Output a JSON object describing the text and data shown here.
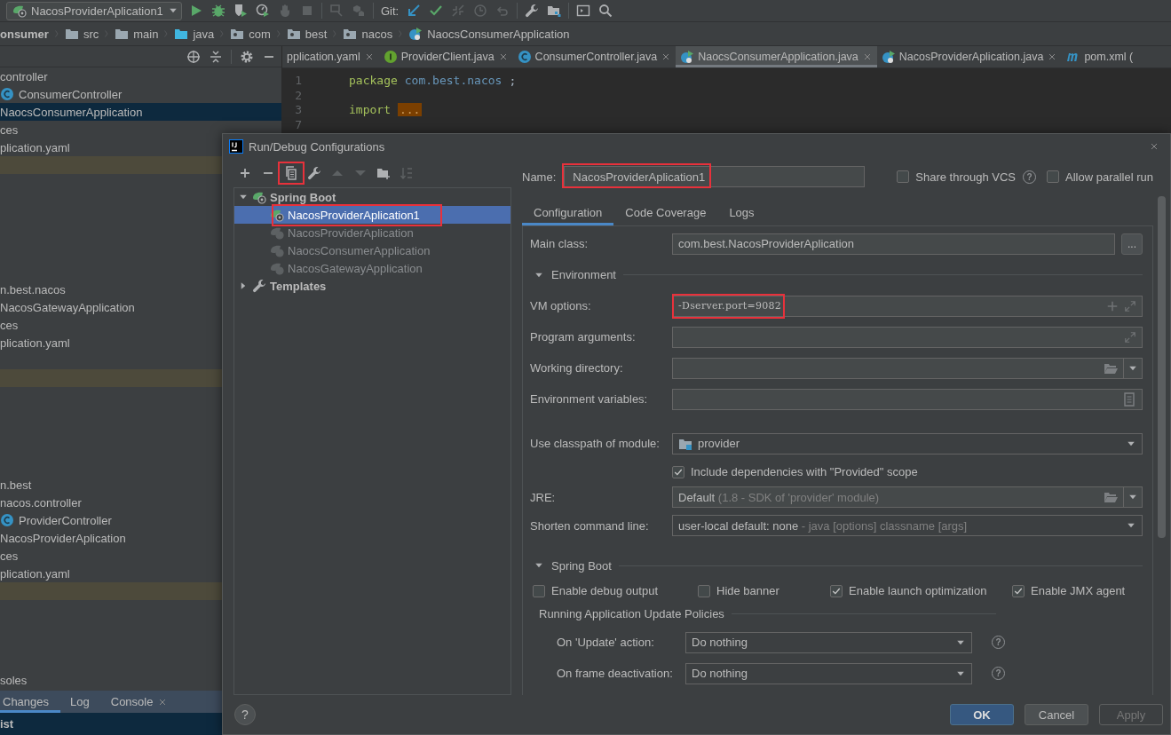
{
  "toolbar": {
    "run_config": "NacosProviderAplication1",
    "groups": [
      {
        "actions": [
          {
            "kind": "run",
            "disabled": false
          },
          {
            "kind": "debug",
            "disabled": false
          },
          {
            "kind": "coverage",
            "disabled": false
          },
          {
            "kind": "profile",
            "disabled": false
          },
          {
            "kind": "attach",
            "disabled": true
          },
          {
            "kind": "stop",
            "disabled": true
          }
        ]
      },
      {
        "actions": [
          {
            "kind": "build",
            "disabled": true
          },
          {
            "kind": "cubes",
            "disabled": true
          }
        ]
      },
      {
        "label": "Git:",
        "actions": [
          {
            "kind": "update",
            "disabled": false
          },
          {
            "kind": "commit",
            "disabled": false
          },
          {
            "kind": "merge",
            "disabled": true
          },
          {
            "kind": "history",
            "disabled": true
          },
          {
            "kind": "rollback",
            "disabled": true
          }
        ]
      },
      {
        "actions": [
          {
            "kind": "wrench",
            "disabled": false
          },
          {
            "kind": "structure",
            "disabled": false
          }
        ]
      },
      {
        "actions": [
          {
            "kind": "terminal",
            "disabled": false
          },
          {
            "kind": "search",
            "disabled": false
          }
        ]
      }
    ]
  },
  "breadcrumbs": [
    {
      "label": "onsumer",
      "kind": "module"
    },
    {
      "label": "src",
      "kind": "folder"
    },
    {
      "label": "main",
      "kind": "folder"
    },
    {
      "label": "java",
      "kind": "source"
    },
    {
      "label": "com",
      "kind": "package"
    },
    {
      "label": "best",
      "kind": "package"
    },
    {
      "label": "nacos",
      "kind": "package"
    },
    {
      "label": "NaocsConsumerApplication",
      "kind": "spring"
    }
  ],
  "project_tree": [
    {
      "kind": "text",
      "label": "controller",
      "selected": false
    },
    {
      "kind": "class",
      "label": "ConsumerController",
      "selected": false
    },
    {
      "kind": "text",
      "label": "NaocsConsumerApplication",
      "selected": true
    },
    {
      "kind": "text",
      "label": "ces",
      "selected": false
    },
    {
      "kind": "text",
      "label": "plication.yaml",
      "selected": false
    },
    {
      "kind": "band"
    },
    {
      "kind": "blank"
    },
    {
      "kind": "blank"
    },
    {
      "kind": "blank"
    },
    {
      "kind": "blank"
    },
    {
      "kind": "blank"
    },
    {
      "kind": "blank"
    },
    {
      "kind": "text",
      "label": "n.best.nacos",
      "selected": false
    },
    {
      "kind": "text",
      "label": "NacosGatewayApplication",
      "selected": false
    },
    {
      "kind": "text",
      "label": "ces",
      "selected": false
    },
    {
      "kind": "text",
      "label": "plication.yaml",
      "selected": false
    },
    {
      "kind": "blank"
    },
    {
      "kind": "band"
    },
    {
      "kind": "blank"
    },
    {
      "kind": "blank"
    },
    {
      "kind": "blank"
    },
    {
      "kind": "blank"
    },
    {
      "kind": "blank"
    },
    {
      "kind": "text",
      "label": "n.best",
      "selected": false
    },
    {
      "kind": "text",
      "label": "nacos.controller",
      "selected": false
    },
    {
      "kind": "class",
      "label": "ProviderController",
      "selected": false
    },
    {
      "kind": "text",
      "label": "NacosProviderAplication",
      "selected": false
    },
    {
      "kind": "text",
      "label": "ces",
      "selected": false
    },
    {
      "kind": "text",
      "label": "plication.yaml",
      "selected": false
    },
    {
      "kind": "band"
    },
    {
      "kind": "blank"
    },
    {
      "kind": "blank"
    },
    {
      "kind": "blank"
    },
    {
      "kind": "blank"
    },
    {
      "kind": "text",
      "label": "soles",
      "selected": false
    }
  ],
  "editor_tabs": [
    {
      "label": "pplication.yaml",
      "kind": "plain",
      "selected": false
    },
    {
      "label": "ProviderClient.java",
      "kind": "interface",
      "selected": false
    },
    {
      "label": "ConsumerController.java",
      "kind": "class",
      "selected": false
    },
    {
      "label": "NaocsConsumerApplication.java",
      "kind": "spring",
      "selected": true
    },
    {
      "label": "NacosProviderAplication.java",
      "kind": "spring",
      "selected": false
    },
    {
      "label": "pom.xml (",
      "kind": "maven",
      "selected": false
    }
  ],
  "editor_lines": [
    {
      "number": "1",
      "tokens": [
        {
          "text": "package",
          "kind": "keyword"
        },
        {
          "text": "com.best.nacos",
          "kind": "name"
        },
        {
          "text": ";",
          "kind": "plain"
        }
      ]
    },
    {
      "number": "2"
    },
    {
      "number": "3",
      "tokens": [
        {
          "text": "import",
          "kind": "keyword"
        },
        {
          "text": "...",
          "kind": "folded"
        }
      ]
    },
    {
      "number": "7"
    }
  ],
  "bottom_tabs": [
    {
      "label": "Changes",
      "selected": true,
      "closable": false
    },
    {
      "label": "Log",
      "selected": false,
      "closable": false
    },
    {
      "label": "Console",
      "selected": false,
      "closable": true
    }
  ],
  "bottom_row": "ist",
  "dialog": {
    "title": "Run/Debug Configurations",
    "tools": [
      {
        "kind": "add",
        "disabled": false,
        "highlighted": false
      },
      {
        "kind": "remove",
        "disabled": false,
        "highlighted": false
      },
      {
        "kind": "copy",
        "disabled": false,
        "highlighted": true
      },
      {
        "kind": "wrench",
        "disabled": false,
        "highlighted": false
      },
      {
        "kind": "up",
        "disabled": true,
        "highlighted": false
      },
      {
        "kind": "down",
        "disabled": true,
        "highlighted": false
      },
      {
        "kind": "folder",
        "disabled": false,
        "highlighted": false
      },
      {
        "kind": "sort",
        "disabled": true,
        "highlighted": false
      }
    ],
    "tree": [
      {
        "label": "Spring Boot",
        "kind": "spring",
        "expanded": true,
        "children": [
          {
            "label": "NacosProviderAplication1",
            "selected": true,
            "highlighted": true
          },
          {
            "label": "NacosProviderAplication",
            "selected": false,
            "highlighted": false
          },
          {
            "label": "NaocsConsumerApplication",
            "selected": false,
            "highlighted": false
          },
          {
            "label": "NacosGatewayApplication",
            "selected": false,
            "highlighted": false
          }
        ]
      },
      {
        "label": "Templates",
        "kind": "wrench",
        "expanded": false
      }
    ],
    "help_button": "?",
    "name": {
      "label": "Name:",
      "value": "NacosProviderAplication1",
      "highlighted": true
    },
    "share_vcs": {
      "label": "Share through VCS",
      "checked": false,
      "help": "?"
    },
    "allow_parallel": {
      "label": "Allow parallel run",
      "checked": false
    },
    "tabs": [
      {
        "label": "Configuration",
        "selected": true
      },
      {
        "label": "Code Coverage",
        "selected": false
      },
      {
        "label": "Logs",
        "selected": false
      }
    ],
    "rows": [
      {
        "kind": "field",
        "label": "Main class:",
        "value": "com.best.NacosProviderAplication",
        "button": "..."
      },
      {
        "kind": "section",
        "label": "Environment",
        "expanded": true
      },
      {
        "kind": "vm",
        "label": "VM options:",
        "value": "-Dserver.port=9082",
        "highlighted": true
      },
      {
        "kind": "args",
        "label": "Program arguments:"
      },
      {
        "kind": "directory",
        "label": "Working directory:"
      },
      {
        "kind": "envvars",
        "label": "Environment variables:"
      },
      {
        "kind": "module",
        "label": "Use classpath of module:",
        "value": "provider"
      },
      {
        "kind": "checkbox",
        "label": "Include dependencies with \"Provided\" scope",
        "checked": true
      },
      {
        "kind": "jre",
        "label": "JRE:",
        "value": "Default",
        "hint": "(1.8 - SDK of 'provider' module)"
      },
      {
        "kind": "combo",
        "label": "Shorten command line:",
        "value": "user-local default: none",
        "hint": "- java [options] classname [args]"
      },
      {
        "kind": "section",
        "label": "Spring Boot",
        "expanded": true
      },
      {
        "kind": "checks",
        "items": [
          {
            "label": "Enable debug output",
            "checked": false
          },
          {
            "label": "Hide banner",
            "checked": false
          },
          {
            "label": "Enable launch optimization",
            "checked": true
          },
          {
            "label": "Enable JMX agent",
            "checked": true
          }
        ]
      },
      {
        "kind": "subsection",
        "label": "Running Application Update Policies"
      },
      {
        "kind": "policy",
        "label": "On 'Update' action:",
        "value": "Do nothing",
        "help": "?"
      },
      {
        "kind": "policy",
        "label": "On frame deactivation:",
        "value": "Do nothing",
        "help": "?"
      }
    ],
    "buttons": [
      {
        "label": "OK",
        "kind": "default",
        "disabled": false
      },
      {
        "label": "Cancel",
        "kind": "normal",
        "disabled": false
      },
      {
        "label": "Apply",
        "kind": "normal",
        "disabled": true
      }
    ]
  }
}
